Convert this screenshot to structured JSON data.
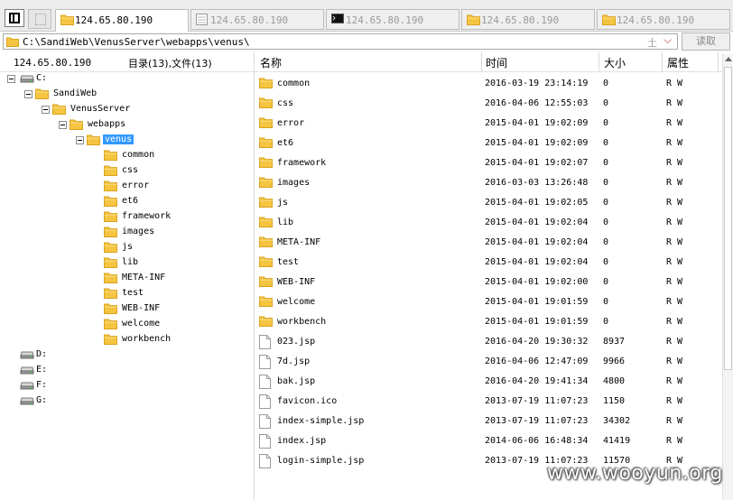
{
  "tabs": [
    {
      "label": "124.65.80.190",
      "icon": "folder-icon",
      "active": true
    },
    {
      "label": "124.65.80.190",
      "icon": "database-icon",
      "active": false
    },
    {
      "label": "124.65.80.190",
      "icon": "terminal-icon",
      "active": false
    },
    {
      "label": "124.65.80.190",
      "icon": "folder-icon",
      "active": false
    },
    {
      "label": "124.65.80.190",
      "icon": "folder-icon",
      "active": false
    }
  ],
  "address": {
    "path": "C:\\SandiWeb\\VenusServer\\webapps\\venus\\",
    "up_glyph": "土",
    "dropdown_glyph": "⌵"
  },
  "read_button": "读取",
  "left": {
    "host": "124.65.80.190",
    "summary": "目录(13),文件(13)",
    "tree": [
      {
        "label": "C:",
        "depth": 0,
        "type": "drive",
        "expanded": true
      },
      {
        "label": "SandiWeb",
        "depth": 1,
        "type": "folder",
        "expanded": true
      },
      {
        "label": "VenusServer",
        "depth": 2,
        "type": "folder",
        "expanded": true
      },
      {
        "label": "webapps",
        "depth": 3,
        "type": "folder",
        "expanded": true
      },
      {
        "label": "venus",
        "depth": 4,
        "type": "folder",
        "expanded": true,
        "selected": true
      },
      {
        "label": "common",
        "depth": 5,
        "type": "folder"
      },
      {
        "label": "css",
        "depth": 5,
        "type": "folder"
      },
      {
        "label": "error",
        "depth": 5,
        "type": "folder"
      },
      {
        "label": "et6",
        "depth": 5,
        "type": "folder"
      },
      {
        "label": "framework",
        "depth": 5,
        "type": "folder"
      },
      {
        "label": "images",
        "depth": 5,
        "type": "folder"
      },
      {
        "label": "js",
        "depth": 5,
        "type": "folder"
      },
      {
        "label": "lib",
        "depth": 5,
        "type": "folder"
      },
      {
        "label": "META-INF",
        "depth": 5,
        "type": "folder"
      },
      {
        "label": "test",
        "depth": 5,
        "type": "folder"
      },
      {
        "label": "WEB-INF",
        "depth": 5,
        "type": "folder"
      },
      {
        "label": "welcome",
        "depth": 5,
        "type": "folder"
      },
      {
        "label": "workbench",
        "depth": 5,
        "type": "folder"
      },
      {
        "label": "D:",
        "depth": 0,
        "type": "drive"
      },
      {
        "label": "E:",
        "depth": 0,
        "type": "drive"
      },
      {
        "label": "F:",
        "depth": 0,
        "type": "drive"
      },
      {
        "label": "G:",
        "depth": 0,
        "type": "drive"
      }
    ]
  },
  "right": {
    "columns": {
      "name": "名称",
      "time": "时间",
      "size": "大小",
      "attr": "属性"
    },
    "rows": [
      {
        "name": "common",
        "time": "2016-03-19 23:14:19",
        "size": "0",
        "attr": "R W",
        "type": "folder"
      },
      {
        "name": "css",
        "time": "2016-04-06 12:55:03",
        "size": "0",
        "attr": "R W",
        "type": "folder"
      },
      {
        "name": "error",
        "time": "2015-04-01 19:02:09",
        "size": "0",
        "attr": "R W",
        "type": "folder"
      },
      {
        "name": "et6",
        "time": "2015-04-01 19:02:09",
        "size": "0",
        "attr": "R W",
        "type": "folder"
      },
      {
        "name": "framework",
        "time": "2015-04-01 19:02:07",
        "size": "0",
        "attr": "R W",
        "type": "folder"
      },
      {
        "name": "images",
        "time": "2016-03-03 13:26:48",
        "size": "0",
        "attr": "R W",
        "type": "folder"
      },
      {
        "name": "js",
        "time": "2015-04-01 19:02:05",
        "size": "0",
        "attr": "R W",
        "type": "folder"
      },
      {
        "name": "lib",
        "time": "2015-04-01 19:02:04",
        "size": "0",
        "attr": "R W",
        "type": "folder"
      },
      {
        "name": "META-INF",
        "time": "2015-04-01 19:02:04",
        "size": "0",
        "attr": "R W",
        "type": "folder"
      },
      {
        "name": "test",
        "time": "2015-04-01 19:02:04",
        "size": "0",
        "attr": "R W",
        "type": "folder"
      },
      {
        "name": "WEB-INF",
        "time": "2015-04-01 19:02:00",
        "size": "0",
        "attr": "R W",
        "type": "folder"
      },
      {
        "name": "welcome",
        "time": "2015-04-01 19:01:59",
        "size": "0",
        "attr": "R W",
        "type": "folder"
      },
      {
        "name": "workbench",
        "time": "2015-04-01 19:01:59",
        "size": "0",
        "attr": "R W",
        "type": "folder"
      },
      {
        "name": "023.jsp",
        "time": "2016-04-20 19:30:32",
        "size": "8937",
        "attr": "R W",
        "type": "file"
      },
      {
        "name": "7d.jsp",
        "time": "2016-04-06 12:47:09",
        "size": "9966",
        "attr": "R W",
        "type": "file"
      },
      {
        "name": "bak.jsp",
        "time": "2016-04-20 19:41:34",
        "size": "4800",
        "attr": "R W",
        "type": "file"
      },
      {
        "name": "favicon.ico",
        "time": "2013-07-19 11:07:23",
        "size": "1150",
        "attr": "R W",
        "type": "file"
      },
      {
        "name": "index-simple.jsp",
        "time": "2013-07-19 11:07:23",
        "size": "34302",
        "attr": "R W",
        "type": "file"
      },
      {
        "name": "index.jsp",
        "time": "2014-06-06 16:48:34",
        "size": "41419",
        "attr": "R W",
        "type": "file"
      },
      {
        "name": "login-simple.jsp",
        "time": "2013-07-19 11:07:23",
        "size": "11570",
        "attr": "R W",
        "type": "file"
      }
    ]
  },
  "watermark": "www.wooyun.org",
  "colors": {
    "selection": "#3399ff",
    "folder": "#f5c542",
    "folder_dark": "#d9a21b"
  }
}
